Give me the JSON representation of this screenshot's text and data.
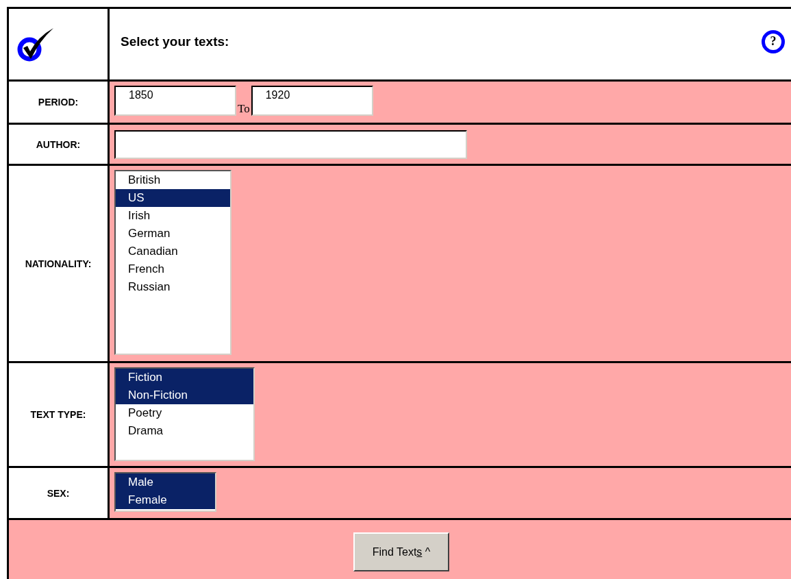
{
  "header": {
    "title": "Select your texts:",
    "help_symbol": "?"
  },
  "fields": [
    {
      "kind": "range",
      "label": "PERIOD:",
      "from": "1850",
      "separator": "To",
      "to": "1920"
    },
    {
      "kind": "text",
      "label": "AUTHOR:"
    },
    {
      "kind": "list",
      "label": "NATIONALITY:",
      "options": [
        {
          "label": "British",
          "selected": false
        },
        {
          "label": "US",
          "selected": true
        },
        {
          "label": "Irish",
          "selected": false
        },
        {
          "label": "German",
          "selected": false
        },
        {
          "label": "Canadian",
          "selected": false
        },
        {
          "label": "French",
          "selected": false
        },
        {
          "label": "Russian",
          "selected": false
        }
      ]
    },
    {
      "kind": "list",
      "label": "TEXT TYPE:",
      "options": [
        {
          "label": "Fiction",
          "selected": true
        },
        {
          "label": "Non-Fiction",
          "selected": true
        },
        {
          "label": "Poetry",
          "selected": false
        },
        {
          "label": "Drama",
          "selected": false
        }
      ]
    },
    {
      "kind": "list",
      "label": "SEX:",
      "options": [
        {
          "label": "Male",
          "selected": true
        },
        {
          "label": "Female",
          "selected": true
        }
      ]
    }
  ],
  "submit": {
    "label_start": "Find Text",
    "access_key": "s",
    "label_end": " ^"
  }
}
